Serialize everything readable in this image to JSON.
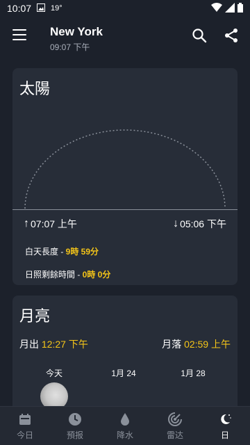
{
  "status_bar": {
    "time": "10:07",
    "temp": "19°"
  },
  "app_bar": {
    "city": "New York",
    "local_time": "09:07 下午"
  },
  "sun": {
    "title": "太陽",
    "sunrise": "07:07 上午",
    "sunset": "05:06 下午",
    "day_length_label": "白天長度 - ",
    "day_length_value": "9時 59分",
    "remaining_label": "日照剩餘時間 - ",
    "remaining_value": "0時 0分"
  },
  "moon": {
    "title": "月亮",
    "moonrise_label": "月出",
    "moonrise_value": "12:27 下午",
    "moonset_label": "月落",
    "moonset_value": "02:59 上午",
    "phases": [
      "今天",
      "1月 24",
      "1月 28"
    ]
  },
  "bottom_nav": [
    {
      "label": "今日",
      "icon": "calendar-icon"
    },
    {
      "label": "預报",
      "icon": "clock-icon"
    },
    {
      "label": "降水",
      "icon": "drop-icon"
    },
    {
      "label": "雷达",
      "icon": "radar-icon"
    },
    {
      "label": "日",
      "icon": "moon-sun-icon"
    }
  ],
  "colors": {
    "background": "#1c212b",
    "card": "#272d38",
    "accent": "#f5c518"
  }
}
